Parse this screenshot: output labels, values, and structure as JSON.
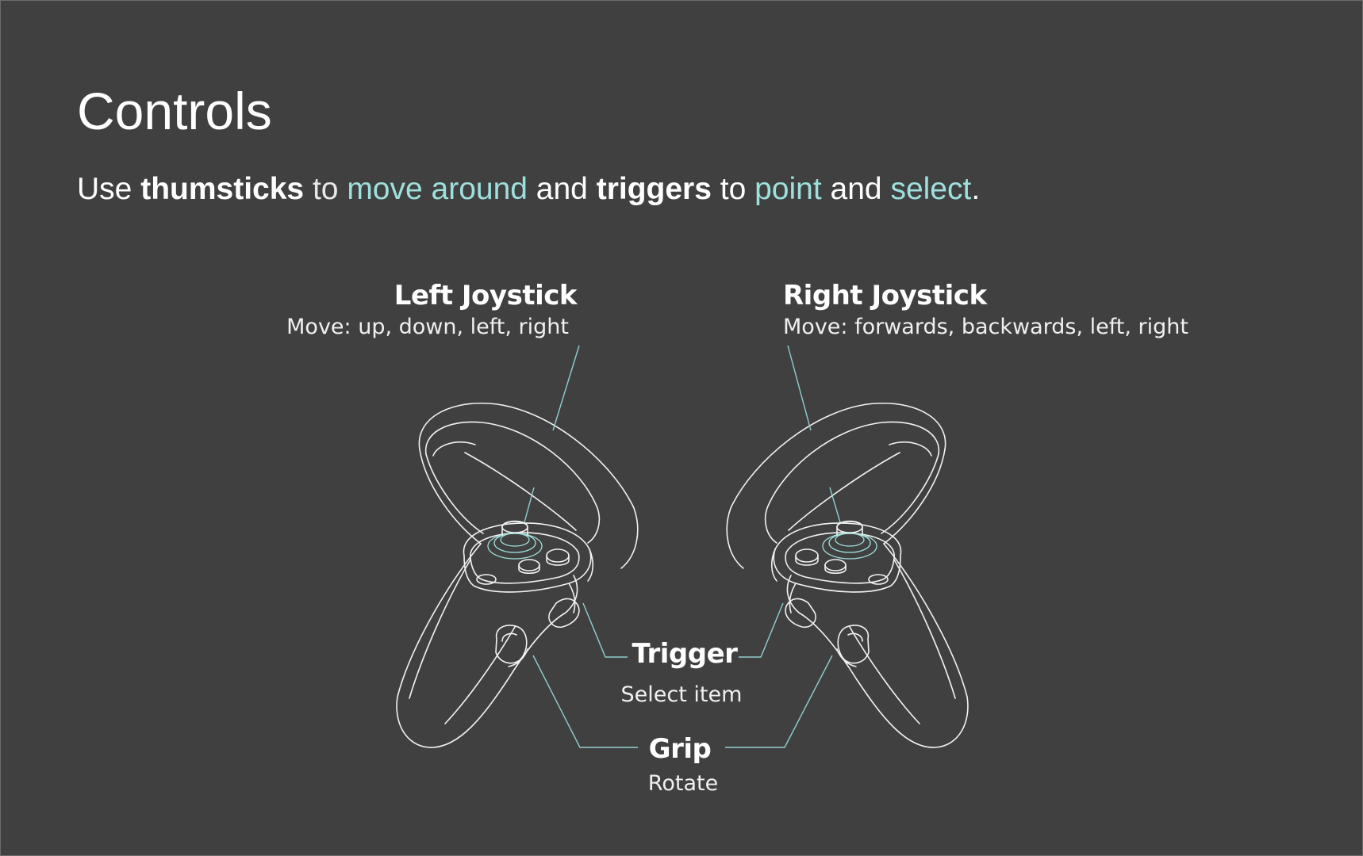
{
  "header": {
    "title": "Controls"
  },
  "intro": {
    "p1": "Use ",
    "p2": "thumsticks",
    "p3": " to ",
    "p4": "move around",
    "p5": " and ",
    "p6": "triggers",
    "p7": " to ",
    "p8": "point",
    "p9": " and ",
    "p10": "select",
    "p11": "."
  },
  "labels": {
    "left_joystick": {
      "title": "Left Joystick",
      "desc": "Move: up, down, left, right"
    },
    "right_joystick": {
      "title": "Right Joystick",
      "desc": "Move: forwards, backwards, left, right"
    },
    "trigger": {
      "title": "Trigger",
      "desc": "Select item"
    },
    "grip": {
      "title": "Grip",
      "desc": "Rotate"
    }
  },
  "colors": {
    "background": "#404040",
    "text": "#ffffff",
    "highlight": "#9ee0dc",
    "outline": "#f2f2f2",
    "leader": "#8fcfcf"
  },
  "icons": [
    "left-controller-icon",
    "right-controller-icon"
  ]
}
